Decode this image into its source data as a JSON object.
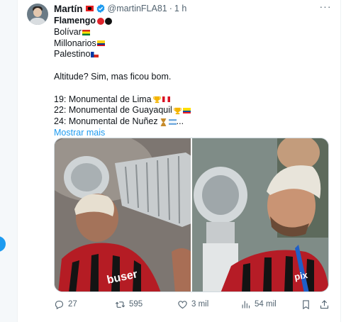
{
  "post": {
    "author_name": "Martín",
    "handle": "@martinFLA81",
    "separator": "·",
    "time": "1 h",
    "more_glyph": "···",
    "lines": {
      "flamengo": "Flamengo",
      "bolivar": "Bolívar",
      "millonarios": "Millonarios",
      "palestino": "Palestino",
      "altitude": "Altitude? Sim, mas ficou bom.",
      "lima": "19: Monumental de Lima",
      "guayaquil": "22: Monumental de Guayaquil",
      "nunez": "24: Monumental de Nuñez",
      "ellipsis": "...",
      "show_more": "Mostrar mais"
    }
  },
  "actions": {
    "replies": "27",
    "reposts": "595",
    "likes": "3 mil",
    "views": "54 mil"
  },
  "colors": {
    "text": "#0f1419",
    "secondary": "#536471",
    "accent": "#1d9bf0",
    "flamengo_red": "#e0232b",
    "flamengo_black": "#111111"
  },
  "icons": [
    "albania-flag-icon",
    "verified-badge-icon",
    "more-icon",
    "reply-icon",
    "repost-icon",
    "like-icon",
    "views-icon",
    "bookmark-icon",
    "share-icon"
  ]
}
